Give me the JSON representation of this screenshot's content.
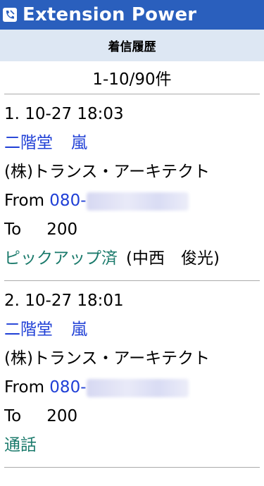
{
  "app": {
    "title": "Extension Power",
    "logo_icon": "phone-icon"
  },
  "page": {
    "heading": "着信履歴",
    "count": "1-10/90件"
  },
  "entries": [
    {
      "index": "1.",
      "datetime": "10-27 18:03",
      "caller_last": "二階堂",
      "caller_first": "嵐",
      "company": "(株)トランス・アーキテクト",
      "from_label": "From",
      "from_number": "080-",
      "to_label": "To",
      "to_number": "200",
      "status": "ピックアップ済",
      "handled_by": "(中西　俊光)"
    },
    {
      "index": "2.",
      "datetime": "10-27 18:01",
      "caller_last": "二階堂",
      "caller_first": "嵐",
      "company": "(株)トランス・アーキテクト",
      "from_label": "From",
      "from_number": "080-",
      "to_label": "To",
      "to_number": "200",
      "status": "通話",
      "handled_by": ""
    }
  ],
  "colors": {
    "header": "#2a5fbd",
    "subheader": "#dde7f3",
    "link": "#1f3fd6",
    "status": "#1a7a6b"
  }
}
